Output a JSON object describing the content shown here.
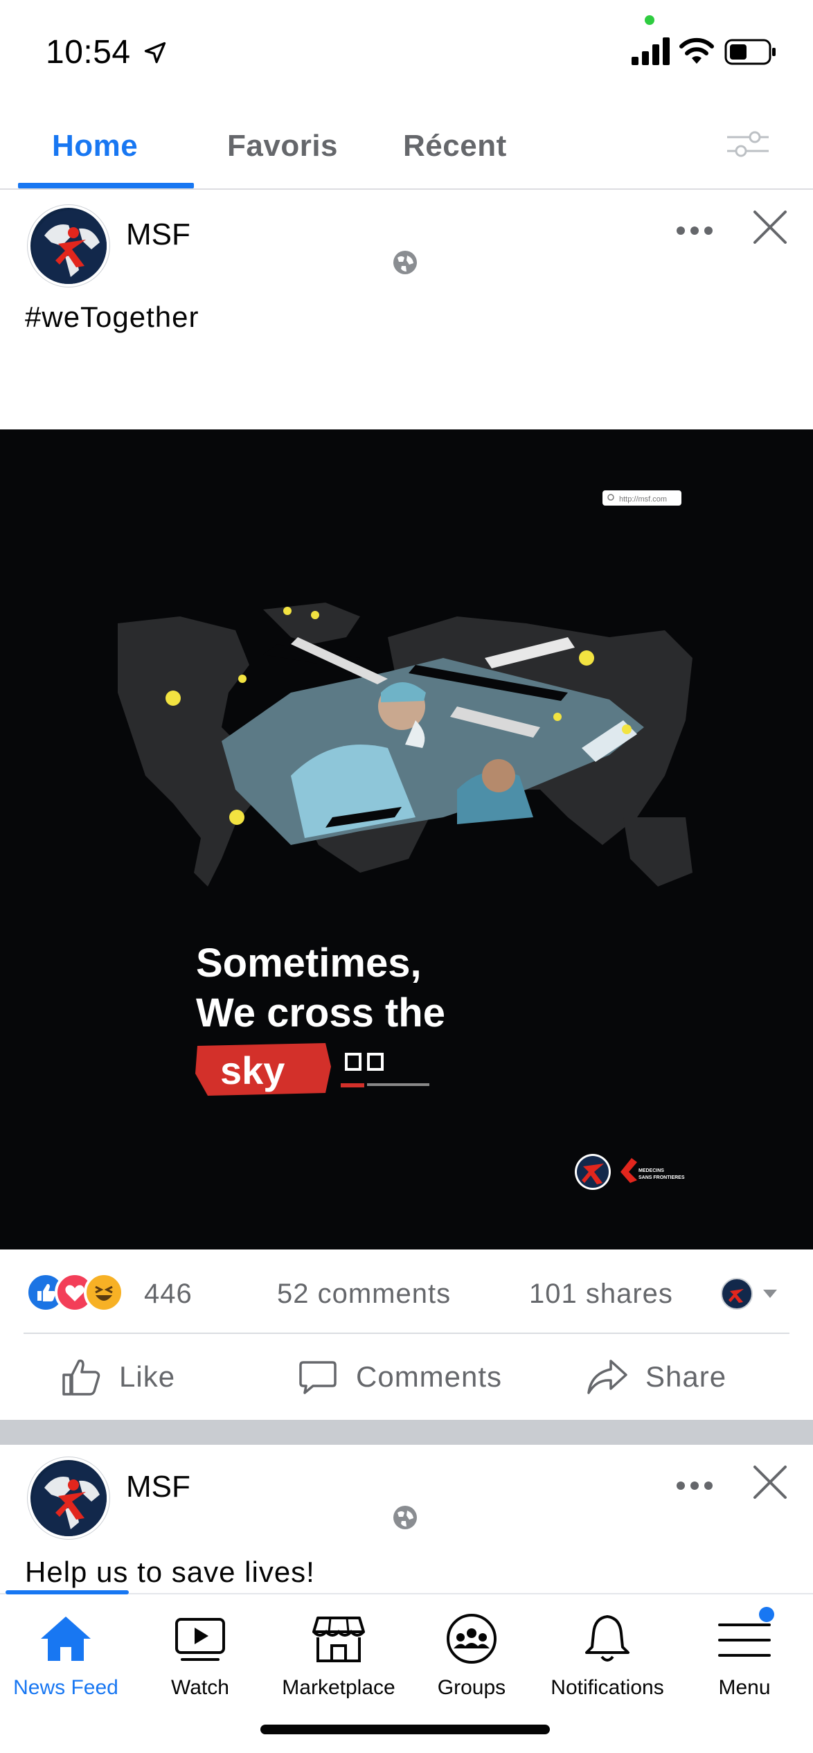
{
  "status_bar": {
    "time": "10:54"
  },
  "tabs": [
    {
      "label": "Home",
      "active": true
    },
    {
      "label": "Favoris",
      "active": false
    },
    {
      "label": "Récent",
      "active": false
    }
  ],
  "posts": [
    {
      "page_name": "MSF",
      "text": "#weTogether",
      "image": {
        "url_text": "http://msf.com",
        "headline_line1": "Sometimes,",
        "headline_line2": "We cross the",
        "headline_highlight": "sky",
        "logo_text": "MEDECINS SANS FRONTIERES"
      },
      "reactions_count": "446",
      "comments_count": "52 comments",
      "shares_count": "101 shares",
      "actions": {
        "like": "Like",
        "comment": "Comments",
        "share": "Share"
      }
    },
    {
      "page_name": "MSF",
      "text": "Help us to save lives!"
    }
  ],
  "bottom_nav": [
    {
      "label": "News Feed",
      "icon": "home-icon",
      "active": true
    },
    {
      "label": "Watch",
      "icon": "watch-icon",
      "active": false
    },
    {
      "label": "Marketplace",
      "icon": "marketplace-icon",
      "active": false
    },
    {
      "label": "Groups",
      "icon": "groups-icon",
      "active": false
    },
    {
      "label": "Notifications",
      "icon": "bell-icon",
      "active": false
    },
    {
      "label": "Menu",
      "icon": "menu-icon",
      "active": false
    }
  ],
  "colors": {
    "accent": "#1877f2",
    "msf_red": "#d3302a",
    "image_bg": "#060709"
  }
}
